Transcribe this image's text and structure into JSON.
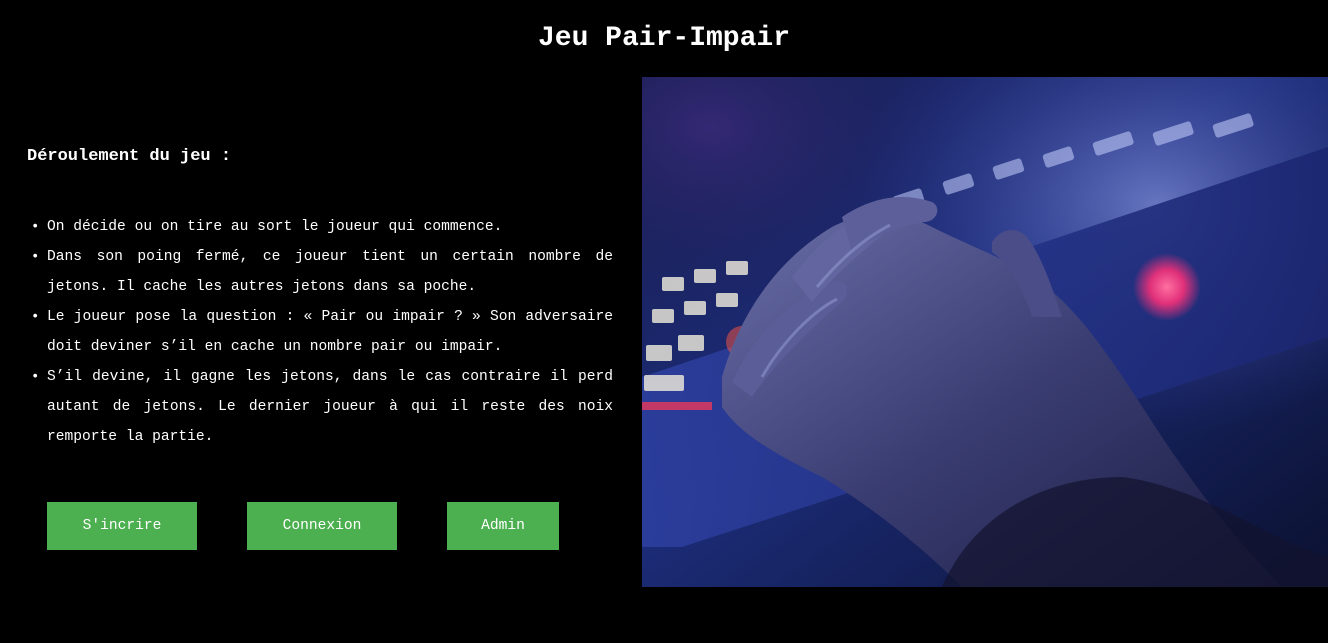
{
  "header": {
    "title": "Jeu Pair-Impair"
  },
  "rules": {
    "heading": "Déroulement du jeu :",
    "items": [
      "On décide ou on tire au sort le joueur qui commence.",
      "Dans son poing fermé, ce joueur tient un certain nombre de jetons. Il cache les autres jetons dans sa poche.",
      "Le joueur pose la question : « Pair ou impair ? » Son adversaire doit deviner s’il en cache un nombre pair ou impair.",
      "S’il devine, il gagne les jetons, dans le cas contraire il perd autant de jetons. Le dernier joueur à qui il reste des noix remporte la partie."
    ]
  },
  "actions": {
    "register_label": "S'incrire",
    "login_label": "Connexion",
    "admin_label": "Admin"
  },
  "image": {
    "subject": "hand-on-backlit-keyboard-photo"
  },
  "colors": {
    "background": "#000000",
    "text": "#ffffff",
    "button": "#4caf50"
  }
}
